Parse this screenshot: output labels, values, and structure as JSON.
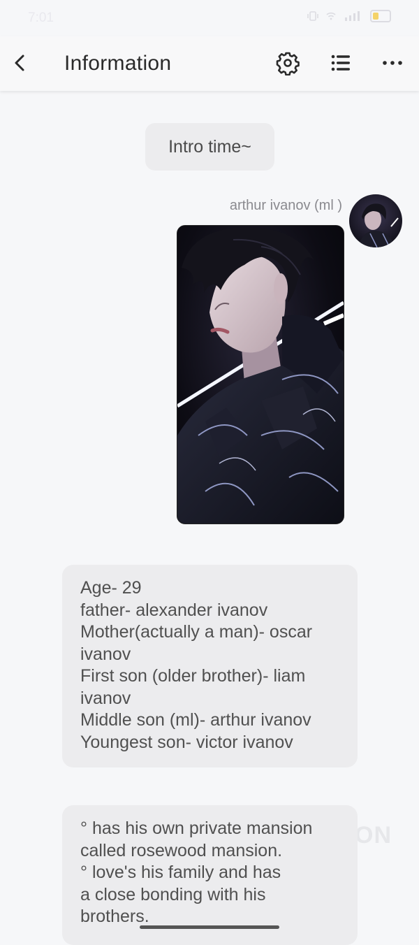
{
  "status_bar": {
    "time": "7:01"
  },
  "app_bar": {
    "title": "Information"
  },
  "intro_chip": "Intro time~",
  "message": {
    "sender_name": "arthur ivanov (ml )"
  },
  "bubble1_lines": [
    "Age- 29",
    "father- alexander ivanov",
    "Mother(actually a man)- oscar",
    "ivanov",
    "First son (older brother)- liam",
    "ivanov",
    "Middle son (ml)- arthur ivanov",
    "Youngest son- victor ivanov"
  ],
  "bubble2_lines": [
    "° has his own private mansion",
    "called rosewood mansion.",
    "° love's his family and has",
    "a close bonding with his",
    "brothers."
  ],
  "watermark": "ON",
  "colors": {
    "background": "#f6f7f9",
    "bubble": "#ececee",
    "text": "#505050"
  }
}
